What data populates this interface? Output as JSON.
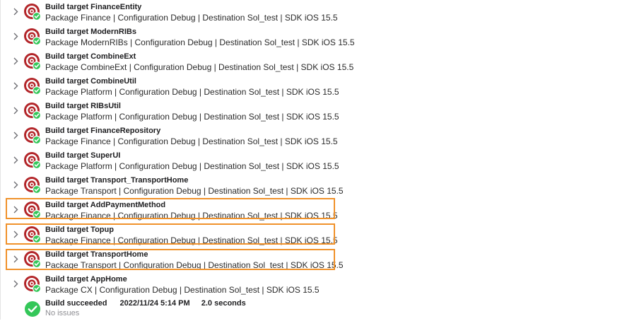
{
  "colors": {
    "target_red": "#b3262a",
    "check_green": "#34c759",
    "highlight_orange": "#f0922b"
  },
  "icons": {
    "row_icon": "target-bullseye-icon",
    "badge": "checkmark-badge-icon",
    "expand": "chevron-right-icon",
    "success": "checkmark-circle-icon"
  },
  "build_log": {
    "rows": [
      {
        "title": "Build target FinanceEntity",
        "detail": "Package Finance | Configuration Debug | Destination Sol_test | SDK iOS 15.5"
      },
      {
        "title": "Build target ModernRIBs",
        "detail": "Package ModernRIBs | Configuration Debug | Destination Sol_test | SDK iOS 15.5"
      },
      {
        "title": "Build target CombineExt",
        "detail": "Package CombineExt | Configuration Debug | Destination Sol_test | SDK iOS 15.5"
      },
      {
        "title": "Build target CombineUtil",
        "detail": "Package Platform | Configuration Debug | Destination Sol_test | SDK iOS 15.5"
      },
      {
        "title": "Build target RIBsUtil",
        "detail": "Package Platform | Configuration Debug | Destination Sol_test | SDK iOS 15.5"
      },
      {
        "title": "Build target FinanceRepository",
        "detail": "Package Finance | Configuration Debug | Destination Sol_test | SDK iOS 15.5"
      },
      {
        "title": "Build target SuperUI",
        "detail": "Package Platform | Configuration Debug | Destination Sol_test | SDK iOS 15.5"
      },
      {
        "title": "Build target Transport_TransportHome",
        "detail": "Package Transport | Configuration Debug | Destination Sol_test | SDK iOS 15.5"
      },
      {
        "title": "Build target AddPaymentMethod",
        "detail": "Package Finance | Configuration Debug | Destination Sol_test | SDK iOS 15.5"
      },
      {
        "title": "Build target Topup",
        "detail": "Package Finance | Configuration Debug | Destination Sol_test | SDK iOS 15.5"
      },
      {
        "title": "Build target TransportHome",
        "detail": "Package Transport | Configuration Debug | Destination Sol_test | SDK iOS 15.5"
      },
      {
        "title": "Build target AppHome",
        "detail": "Package CX | Configuration Debug | Destination Sol_test | SDK iOS 15.5"
      }
    ],
    "result": {
      "status": "Build succeeded",
      "timestamp": "2022/11/24 5:14 PM",
      "duration": "2.0 seconds",
      "issues": "No issues"
    }
  }
}
